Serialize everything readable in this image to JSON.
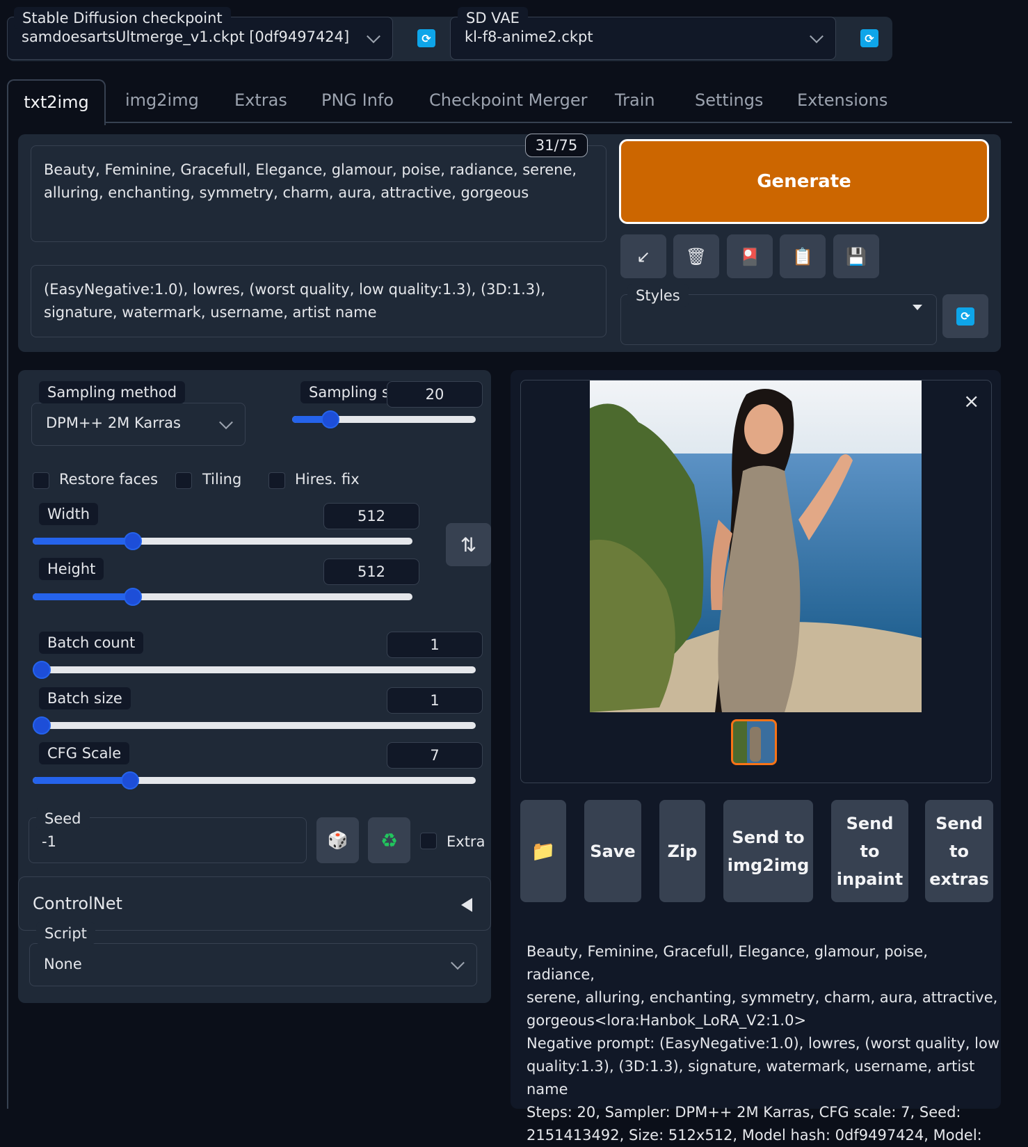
{
  "header": {
    "checkpoint_label": "Stable Diffusion checkpoint",
    "checkpoint_value": "samdoesartsUltmerge_v1.ckpt [0df9497424]",
    "vae_label": "SD VAE",
    "vae_value": "kl-f8-anime2.ckpt"
  },
  "tabs": [
    "txt2img",
    "img2img",
    "Extras",
    "PNG Info",
    "Checkpoint Merger",
    "Train",
    "Settings",
    "Extensions"
  ],
  "prompt": {
    "token_count": "31/75",
    "positive": "Beauty, Feminine, Gracefull, Elegance, glamour, poise, radiance, serene, alluring, enchanting, symmetry, charm, aura, attractive, gorgeous",
    "negative": "(EasyNegative:1.0), lowres, (worst quality, low quality:1.3), (3D:1.3), signature, watermark, username, artist name"
  },
  "generate_label": "Generate",
  "tools": {
    "icons": [
      "arrow-icon",
      "trash-icon",
      "card-icon",
      "clipboard-icon",
      "save-icon"
    ],
    "glyphs": [
      "↙",
      "🗑",
      "🎴",
      "📋",
      "💾"
    ]
  },
  "styles_label": "Styles",
  "sampling": {
    "method_label": "Sampling method",
    "method_value": "DPM++ 2M Karras",
    "steps_label": "Sampling st",
    "steps_value": "20",
    "steps_fraction": 0.16
  },
  "checkboxes": {
    "restore_faces": "Restore faces",
    "tiling": "Tiling",
    "hires_fix": "Hires. fix"
  },
  "size": {
    "width_label": "Width",
    "width_value": "512",
    "width_fraction": 0.24,
    "height_label": "Height",
    "height_value": "512",
    "height_fraction": 0.24,
    "swap_glyph": "⇅"
  },
  "batch": {
    "count_label": "Batch count",
    "count_value": "1",
    "count_fraction": 0.0,
    "size_label": "Batch size",
    "size_value": "1",
    "size_fraction": 0.0,
    "cfg_label": "CFG Scale",
    "cfg_value": "7",
    "cfg_fraction": 0.2
  },
  "seed": {
    "label": "Seed",
    "value": "-1",
    "dice_glyph": "🎲",
    "recycle_glyph": "♻",
    "extra_label": "Extra"
  },
  "controlnet": {
    "label": "ControlNet"
  },
  "script": {
    "label": "Script",
    "value": "None"
  },
  "gallery": {
    "close_glyph": "×",
    "image_description_icon": "image-icon"
  },
  "actions": {
    "folder_glyph": "📁",
    "save": "Save",
    "zip": "Zip",
    "send_img2img_1": "Send to",
    "send_img2img_2": "img2img",
    "send_inpaint_1": "Send",
    "send_inpaint_2": "to",
    "send_inpaint_3": "inpaint",
    "send_extras_1": "Send",
    "send_extras_2": "to",
    "send_extras_3": "extras"
  },
  "info": {
    "lines": [
      "Beauty, Feminine, Gracefull, Elegance, glamour, poise, radiance,",
      "serene, alluring, enchanting, symmetry, charm, aura, attractive,",
      "gorgeous<lora:Hanbok_LoRA_V2:1.0>",
      "Negative prompt: (EasyNegative:1.0), lowres, (worst quality, low",
      "quality:1.3), (3D:1.3), signature, watermark, username, artist name",
      "Steps: 20, Sampler: DPM++ 2M Karras, CFG scale: 7, Seed:",
      "2151413492, Size: 512x512, Model hash: 0df9497424, Model:"
    ]
  },
  "colors": {
    "accent": "#cc6600",
    "slider": "#2563eb",
    "refresh": "#0ea5e9"
  }
}
